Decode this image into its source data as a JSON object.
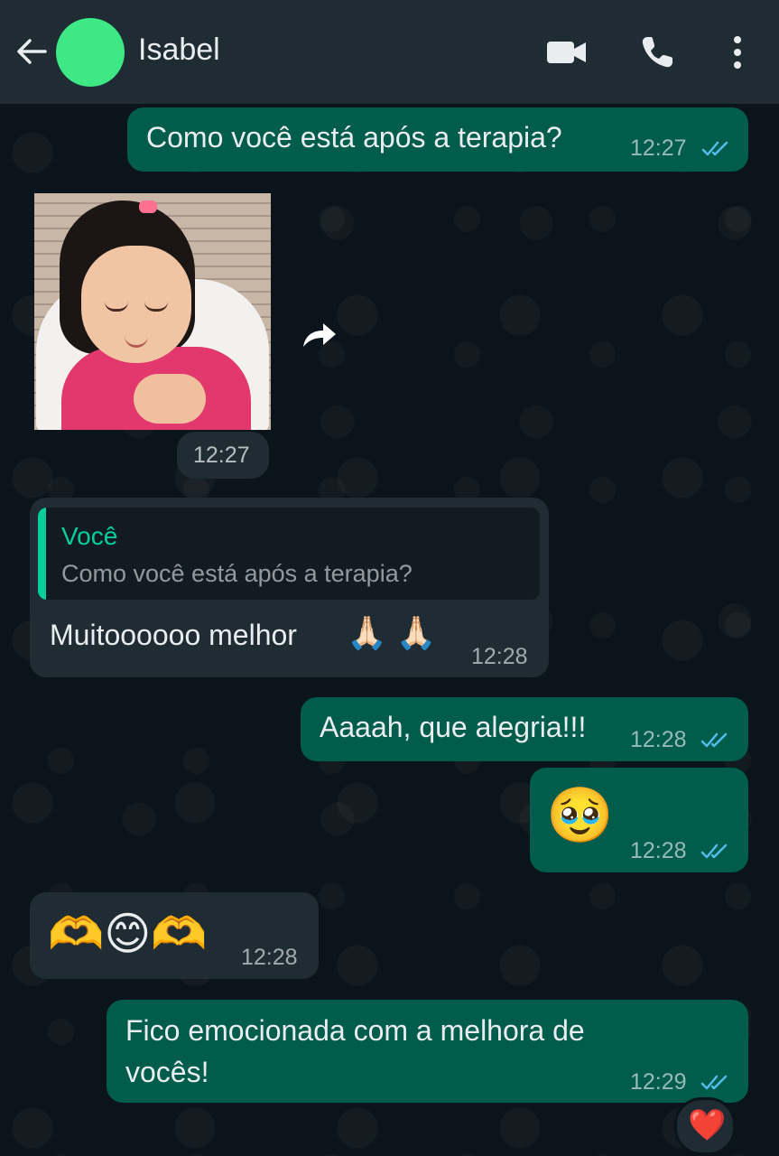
{
  "header": {
    "contact_name": "Isabel",
    "avatar_color": "#3ee985",
    "icons": [
      "back-arrow-icon",
      "video-call-icon",
      "phone-call-icon",
      "more-options-icon"
    ]
  },
  "colors": {
    "outgoing_bubble": "#005c4b",
    "incoming_bubble": "#1f2c34",
    "background": "#0b141a",
    "read_ticks": "#53bdeb",
    "quote_accent": "#06cf9c"
  },
  "messages": [
    {
      "direction": "out",
      "text": "Como você está após a terapia?",
      "time": "12:27",
      "status": "read"
    },
    {
      "direction": "in",
      "type": "image",
      "image_desc": "photo",
      "time": "12:27"
    },
    {
      "direction": "in",
      "quoted_author": "Você",
      "quoted_text": "Como você está após a terapia?",
      "text": "Muitoooooo melhor",
      "emoji": "🙏🏻 🙏🏻",
      "time": "12:28"
    },
    {
      "direction": "out",
      "text": "Aaaah, que alegria!!!",
      "time": "12:28",
      "status": "read"
    },
    {
      "direction": "out",
      "emoji": "🥹",
      "time": "12:28",
      "status": "read"
    },
    {
      "direction": "in",
      "emoji": "🫶😊🫶",
      "time": "12:28"
    },
    {
      "direction": "out",
      "text_line1": "Fico emocionada com a melhora de",
      "text_line2": "vocês!",
      "time": "12:29",
      "status": "read",
      "reaction": "❤️"
    }
  ]
}
